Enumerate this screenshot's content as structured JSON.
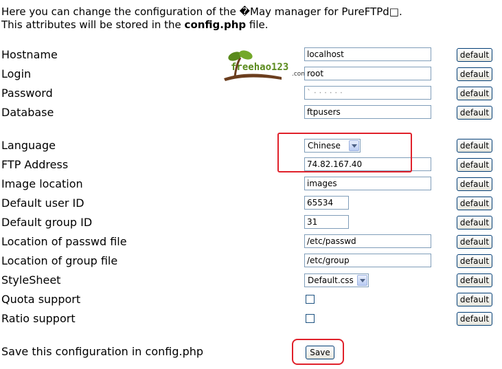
{
  "intro": {
    "line1": "Here you can change the configuration of the �May manager for PureFTPd□.",
    "line2_prefix": "This attributes will be stored in the ",
    "line2_file": "config.php",
    "line2_suffix": " file."
  },
  "fields": {
    "hostname": {
      "label": "Hostname",
      "value": "localhost"
    },
    "login": {
      "label": "Login",
      "value": "root"
    },
    "password": {
      "label": "Password",
      "value": "` · · · · · ·"
    },
    "database": {
      "label": "Database",
      "value": "ftpusers"
    },
    "language": {
      "label": "Language",
      "value": "Chinese"
    },
    "ftp_address": {
      "label": "FTP Address",
      "value": "74.82.167.40"
    },
    "image_location": {
      "label": "Image location",
      "value": "images"
    },
    "default_uid": {
      "label": "Default user ID",
      "value": "65534"
    },
    "default_gid": {
      "label": "Default group ID",
      "value": "31"
    },
    "passwd_file": {
      "label": "Location of passwd file",
      "value": "/etc/passwd"
    },
    "group_file": {
      "label": "Location of group file",
      "value": "/etc/group"
    },
    "stylesheet": {
      "label": "StyleSheet",
      "value": "Default.css"
    },
    "quota": {
      "label": "Quota support",
      "checked": false
    },
    "ratio": {
      "label": "Ratio support",
      "checked": false
    }
  },
  "default_button_label": "default",
  "save": {
    "label": "Save this configuration in config.php",
    "button": "Save"
  },
  "watermark": {
    "text": "freehao123",
    "suffix": ".com"
  },
  "colors": {
    "highlight": "#e0202a",
    "logo": "#5a8a1c"
  }
}
